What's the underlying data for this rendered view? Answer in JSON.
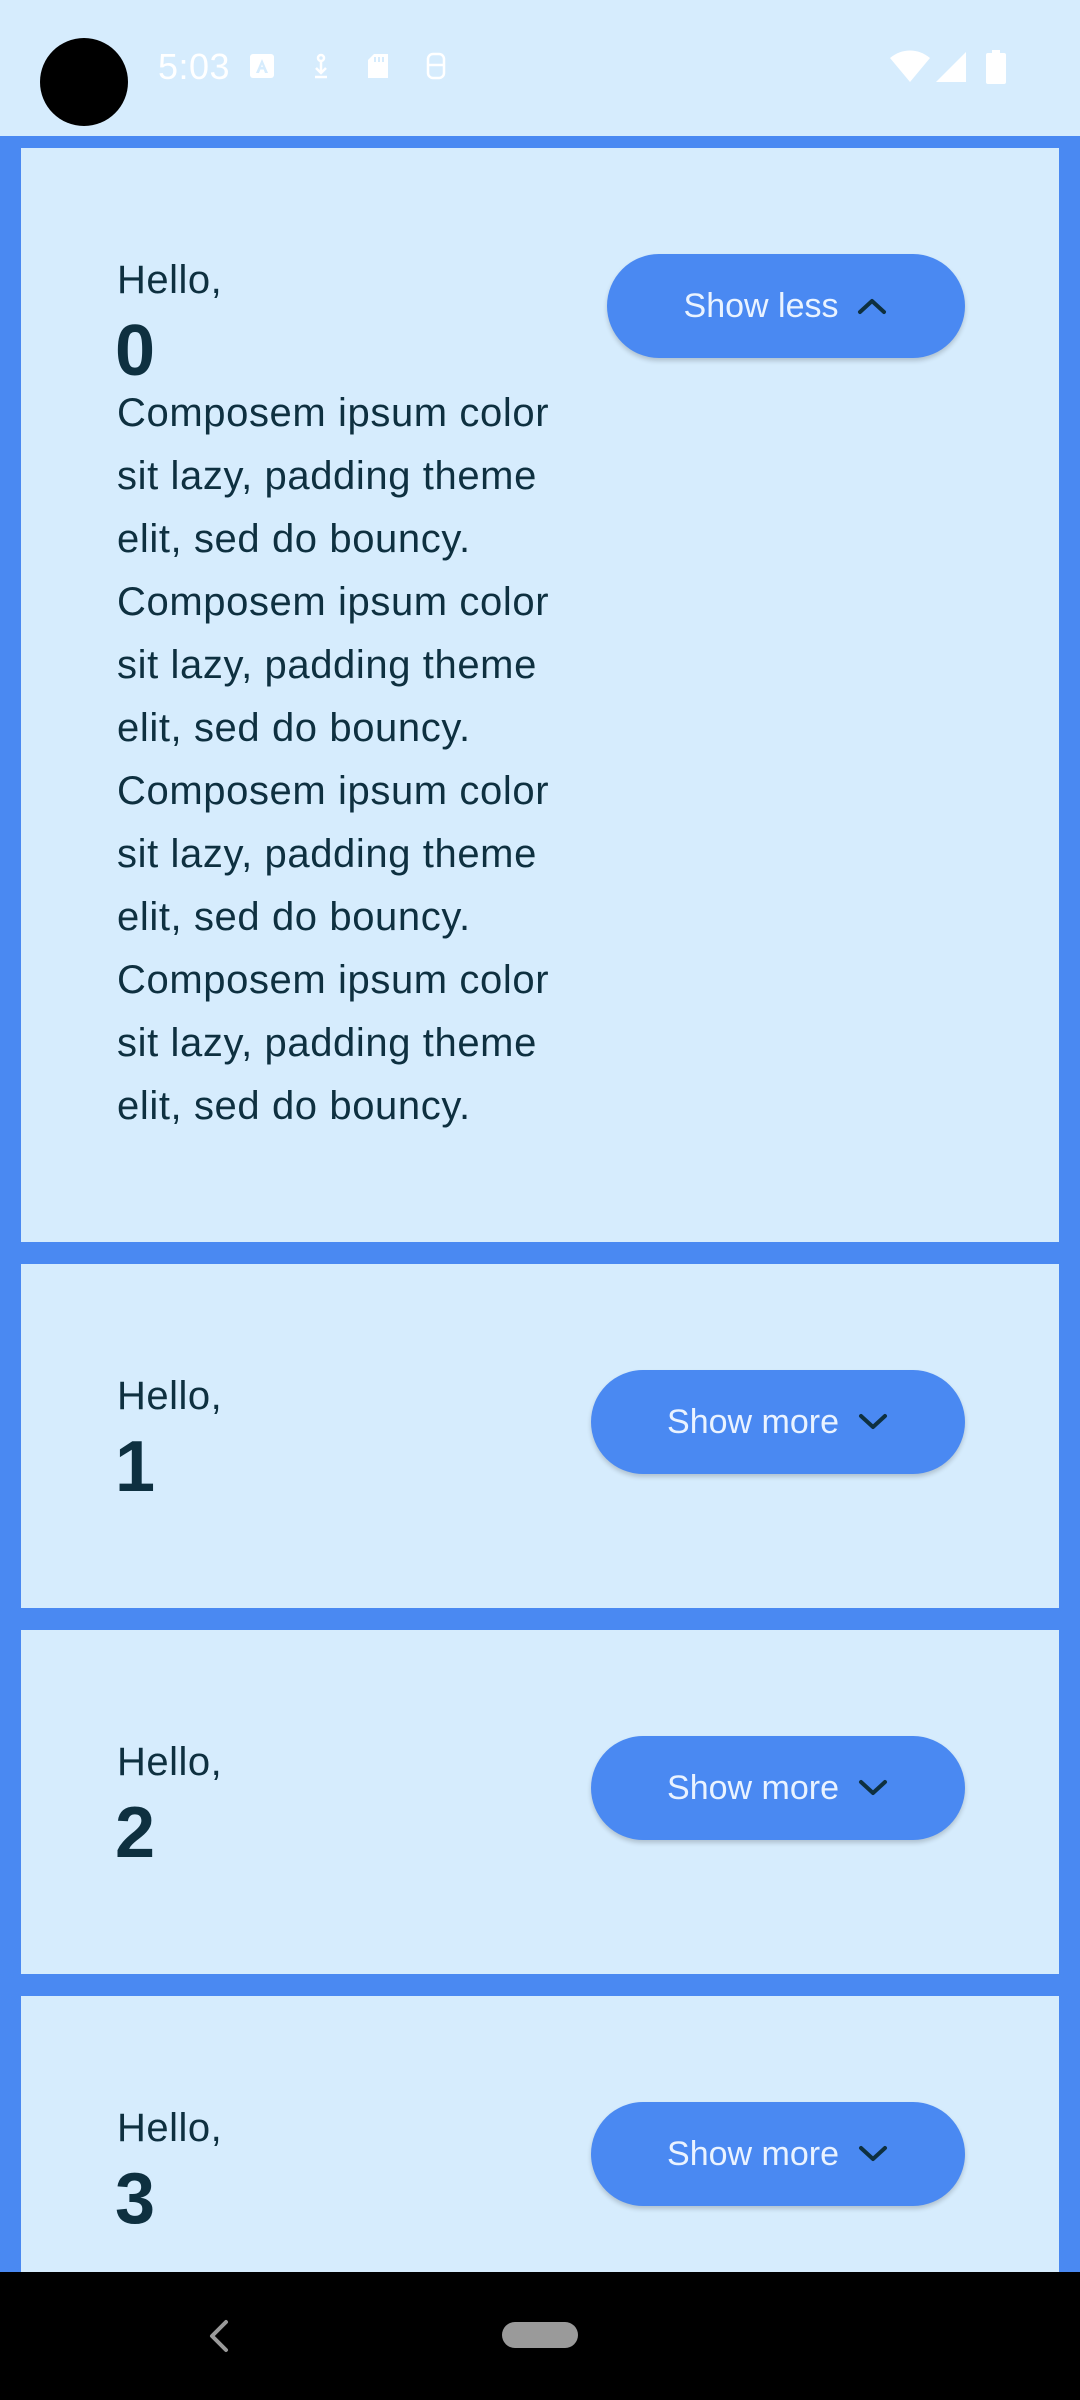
{
  "status_bar": {
    "time": "5:03",
    "icons": [
      "text-a-icon",
      "download-icon",
      "sd-card-icon",
      "data-saver-icon",
      "wifi-icon",
      "signal-icon",
      "battery-icon"
    ]
  },
  "cards": [
    {
      "greeting": "Hello,",
      "number": "0",
      "expanded": true,
      "button_label": "Show less",
      "button_icon": "chevron-up-icon",
      "body_lines": [
        "Composem ipsum color",
        "sit lazy, padding theme",
        "elit, sed do bouncy.",
        "Composem ipsum color",
        "sit lazy, padding theme",
        "elit, sed do bouncy.",
        "Composem ipsum color",
        "sit lazy, padding theme",
        "elit, sed do bouncy.",
        "Composem ipsum color",
        "sit lazy, padding theme",
        "elit, sed do bouncy."
      ]
    },
    {
      "greeting": "Hello,",
      "number": "1",
      "expanded": false,
      "button_label": "Show more",
      "button_icon": "chevron-down-icon"
    },
    {
      "greeting": "Hello,",
      "number": "2",
      "expanded": false,
      "button_label": "Show more",
      "button_icon": "chevron-down-icon"
    },
    {
      "greeting": "Hello,",
      "number": "3",
      "expanded": false,
      "button_label": "Show more",
      "button_icon": "chevron-down-icon"
    }
  ],
  "colors": {
    "background": "#4A89F2",
    "card": "#D6ECFD",
    "text": "#0E3040",
    "button": "#4A89F2",
    "button_text": "#EAF3FF"
  },
  "nav_bar": {
    "icons": [
      "back-icon",
      "home-pill"
    ]
  }
}
